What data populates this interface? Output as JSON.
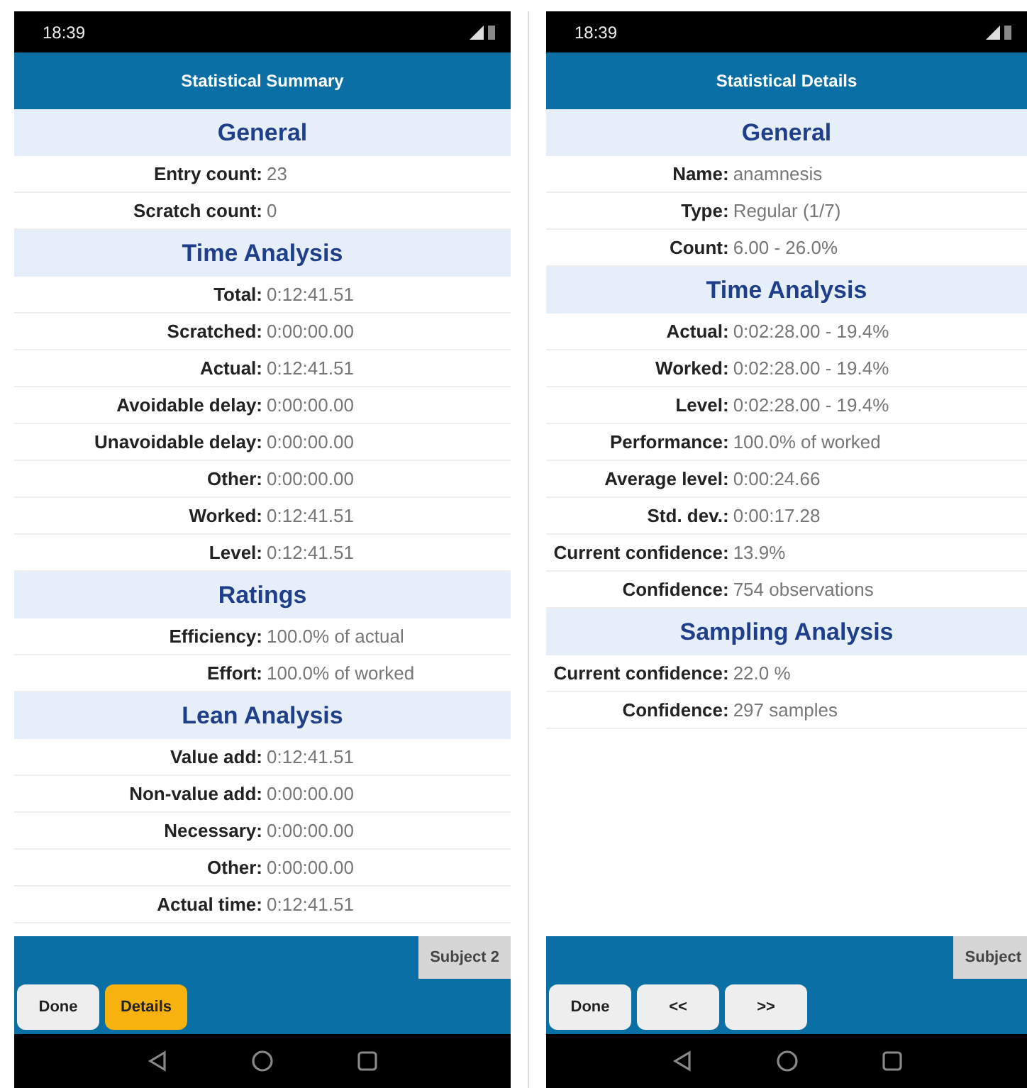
{
  "screens": [
    {
      "status_bar": {
        "time": "18:39"
      },
      "title": "Statistical Summary",
      "sections": [
        {
          "heading": "General",
          "rows": [
            {
              "label": "Entry count:",
              "value": "23"
            },
            {
              "label": "Scratch count:",
              "value": "0"
            }
          ]
        },
        {
          "heading": "Time Analysis",
          "rows": [
            {
              "label": "Total:",
              "value": "0:12:41.51"
            },
            {
              "label": "Scratched:",
              "value": "0:00:00.00"
            },
            {
              "label": "Actual:",
              "value": "0:12:41.51"
            },
            {
              "label": "Avoidable delay:",
              "value": "0:00:00.00"
            },
            {
              "label": "Unavoidable delay:",
              "value": "0:00:00.00"
            },
            {
              "label": "Other:",
              "value": "0:00:00.00"
            },
            {
              "label": "Worked:",
              "value": "0:12:41.51"
            },
            {
              "label": "Level:",
              "value": "0:12:41.51"
            }
          ]
        },
        {
          "heading": "Ratings",
          "rows": [
            {
              "label": "Efficiency:",
              "value": "100.0% of actual"
            },
            {
              "label": "Effort:",
              "value": "100.0% of worked"
            }
          ]
        },
        {
          "heading": "Lean Analysis",
          "rows": [
            {
              "label": "Value add:",
              "value": "0:12:41.51"
            },
            {
              "label": "Non-value add:",
              "value": "0:00:00.00"
            },
            {
              "label": "Necessary:",
              "value": "0:00:00.00"
            },
            {
              "label": "Other:",
              "value": "0:00:00.00"
            },
            {
              "label": "Actual time:",
              "value": "0:12:41.51"
            }
          ]
        }
      ],
      "tab": "Subject 2",
      "buttons": [
        {
          "label": "Done",
          "highlighted": false
        },
        {
          "label": "Details",
          "highlighted": true
        }
      ]
    },
    {
      "status_bar": {
        "time": "18:39"
      },
      "title": "Statistical Details",
      "sections": [
        {
          "heading": "General",
          "rows": [
            {
              "label": "Name:",
              "value": "anamnesis"
            },
            {
              "label": "Type:",
              "value": "Regular (1/7)"
            },
            {
              "label": "Count:",
              "value": "6.00 - 26.0%"
            }
          ]
        },
        {
          "heading": "Time Analysis",
          "rows": [
            {
              "label": "Actual:",
              "value": "0:02:28.00 - 19.4%"
            },
            {
              "label": "Worked:",
              "value": "0:02:28.00 - 19.4%"
            },
            {
              "label": "Level:",
              "value": "0:02:28.00 - 19.4%"
            },
            {
              "label": "Performance:",
              "value": "100.0% of worked"
            },
            {
              "label": "Average level:",
              "value": "0:00:24.66"
            },
            {
              "label": "Std. dev.:",
              "value": "0:00:17.28"
            },
            {
              "label": "Current confidence:",
              "value": "13.9%"
            },
            {
              "label": "Confidence:",
              "value": "754 observations"
            }
          ]
        },
        {
          "heading": "Sampling Analysis",
          "rows": [
            {
              "label": "Current confidence:",
              "value": "22.0 %"
            },
            {
              "label": "Confidence:",
              "value": "297 samples"
            }
          ]
        }
      ],
      "tab": "Subject",
      "buttons": [
        {
          "label": "Done",
          "highlighted": false
        },
        {
          "label": "<<",
          "highlighted": false
        },
        {
          "label": ">>",
          "highlighted": false
        }
      ]
    }
  ]
}
